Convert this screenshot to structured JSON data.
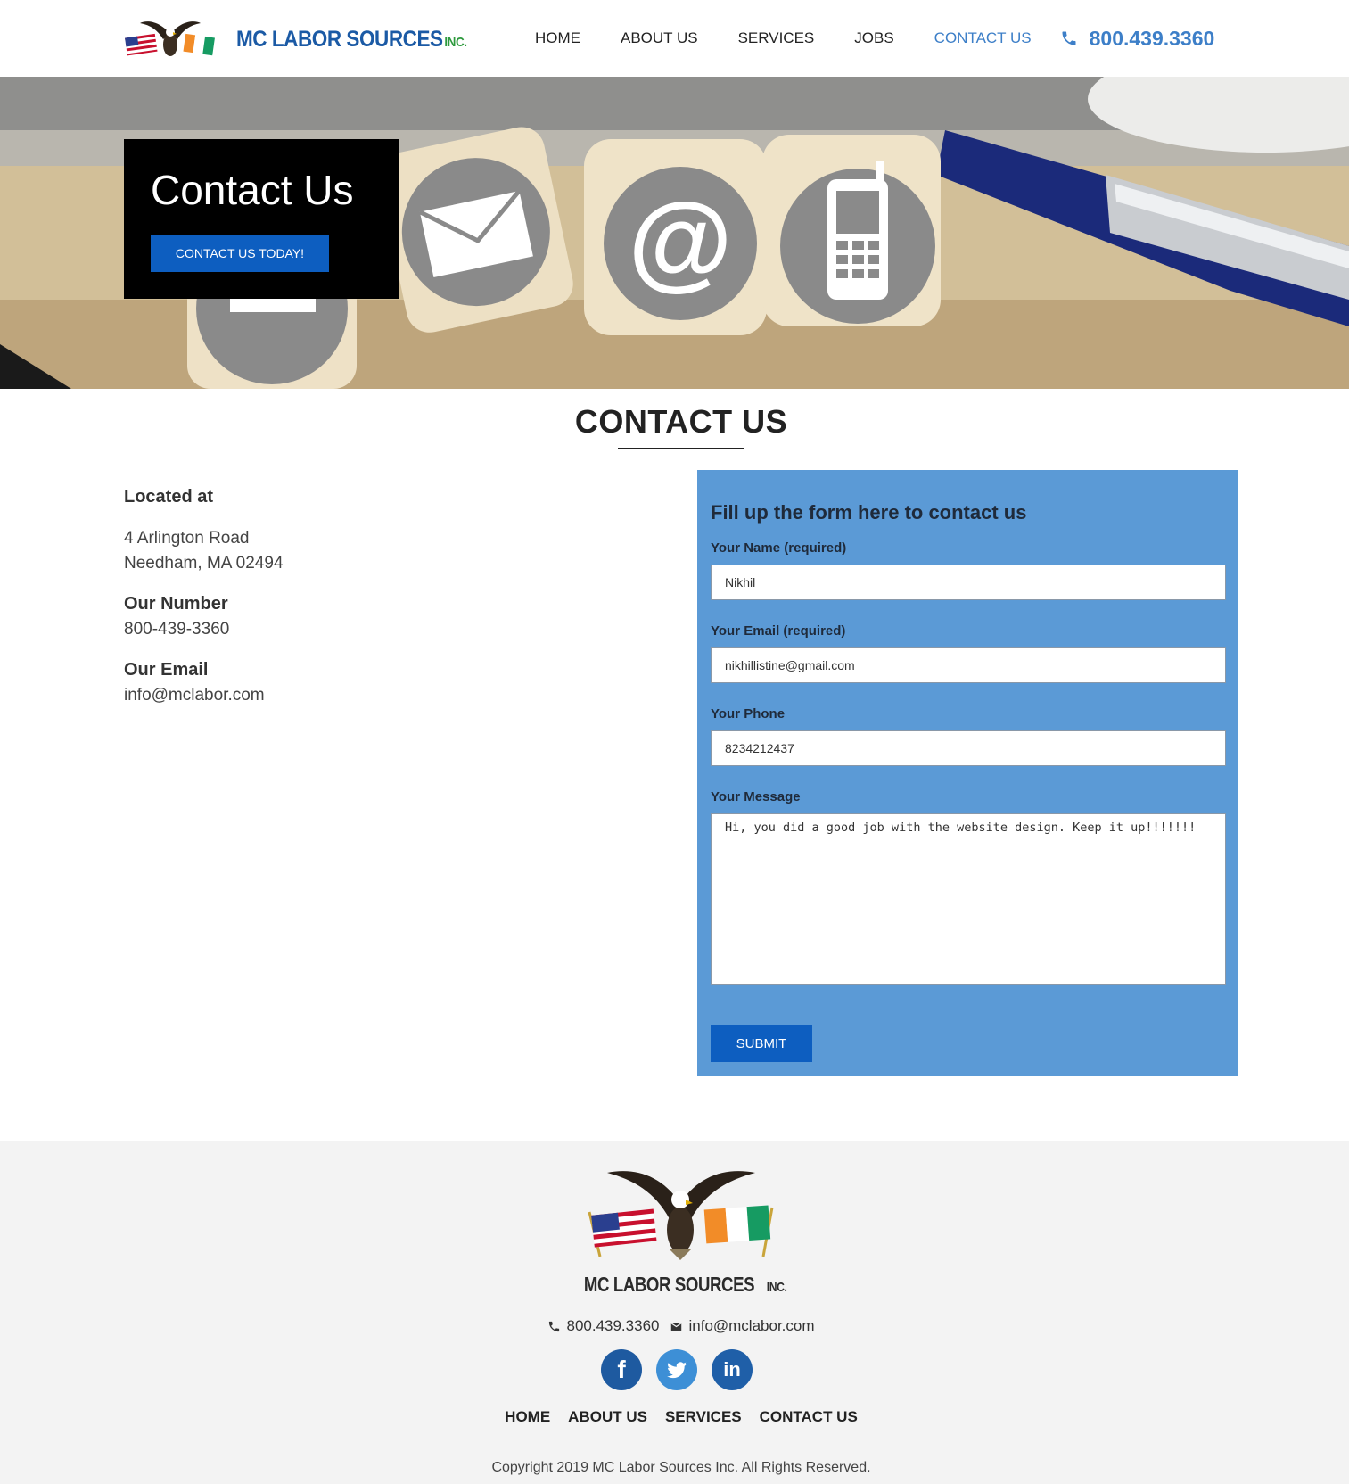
{
  "brand": {
    "name": "MC LABOR SOURCES",
    "suffix": "INC."
  },
  "nav": {
    "items": [
      "HOME",
      "ABOUT US",
      "SERVICES",
      "JOBS",
      "CONTACT US"
    ],
    "active": "CONTACT US",
    "phone": "800.439.3360"
  },
  "hero": {
    "title": "Contact Us",
    "button": "CONTACT US TODAY!"
  },
  "main": {
    "title": "CONTACT US"
  },
  "info": {
    "location_label": "Located at",
    "address_line1": "4 Arlington Road",
    "address_line2": "Needham, MA 02494",
    "number_label": "Our Number",
    "number": "800-439-3360",
    "email_label": "Our Email",
    "email": "info@mclabor.com"
  },
  "form": {
    "heading": "Fill up the form here to contact us",
    "name_label": "Your Name (required)",
    "name_value": "Nikhil",
    "email_label": "Your Email (required)",
    "email_value": "nikhillistine@gmail.com",
    "phone_label": "Your Phone",
    "phone_value": "8234212437",
    "message_label": "Your Message",
    "message_value": "Hi, you did a good job with the website design. Keep it up!!!!!!!",
    "submit": "SUBMIT"
  },
  "footer": {
    "brand": "MC LABOR SOURCES",
    "brand_suffix": "INC.",
    "phone": "800.439.3360",
    "email": "info@mclabor.com",
    "socials": [
      "facebook-icon",
      "twitter-icon",
      "linkedin-icon"
    ],
    "nav": [
      "HOME",
      "ABOUT US",
      "SERVICES",
      "CONTACT US"
    ],
    "copyright": "Copyright 2019 MC Labor Sources Inc. All Rights Reserved."
  },
  "colors": {
    "brand_blue": "#1b5aa5",
    "accent_blue": "#3d7fc8",
    "button_blue": "#0d5ec0",
    "form_panel": "#5b9ad6",
    "footer_bg": "#f3f3f3"
  }
}
